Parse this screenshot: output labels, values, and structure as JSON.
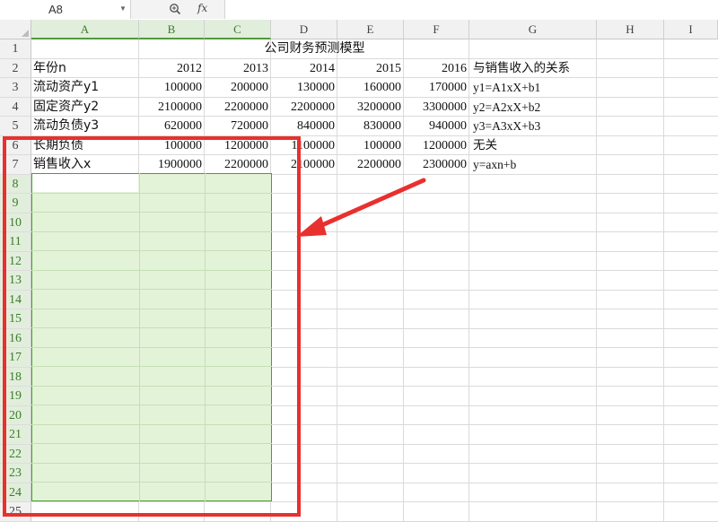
{
  "formula_bar": {
    "name_box": "A8",
    "fx_label": "fx",
    "formula_value": ""
  },
  "columns": [
    "A",
    "B",
    "C",
    "D",
    "E",
    "F",
    "G",
    "H",
    "I"
  ],
  "rows": [
    "1",
    "2",
    "3",
    "4",
    "5",
    "6",
    "7",
    "8",
    "9",
    "10",
    "11",
    "12",
    "13",
    "14",
    "15",
    "16",
    "17",
    "18",
    "19",
    "20",
    "21",
    "22",
    "23",
    "24",
    "25"
  ],
  "sheet": {
    "title": "公司财务预测模型",
    "year_label": "年份n",
    "years": [
      "2012",
      "2013",
      "2014",
      "2015",
      "2016"
    ],
    "relation_header": "与销售收入的关系",
    "data_rows": [
      {
        "label": "流动资产y1",
        "values": [
          "100000",
          "200000",
          "130000",
          "160000",
          "170000"
        ],
        "relation": "y1=A1xX+b1"
      },
      {
        "label": "固定资产y2",
        "values": [
          "2100000",
          "2200000",
          "2200000",
          "3200000",
          "3300000"
        ],
        "relation": "y2=A2xX+b2"
      },
      {
        "label": "流动负债y3",
        "values": [
          "620000",
          "720000",
          "840000",
          "830000",
          "940000"
        ],
        "relation": "y3=A3xX+b3"
      },
      {
        "label": "长期负债",
        "values": [
          "100000",
          "1200000",
          "1100000",
          "100000",
          "1200000"
        ],
        "relation": "无关"
      },
      {
        "label": "销售收入x",
        "values": [
          "1900000",
          "2200000",
          "2100000",
          "2200000",
          "2300000"
        ],
        "relation": "y=axn+b"
      }
    ]
  },
  "colors": {
    "selection_fill": "#e3f3d8",
    "selection_border": "#4f9a3a",
    "annotation_red": "#e8302f"
  }
}
